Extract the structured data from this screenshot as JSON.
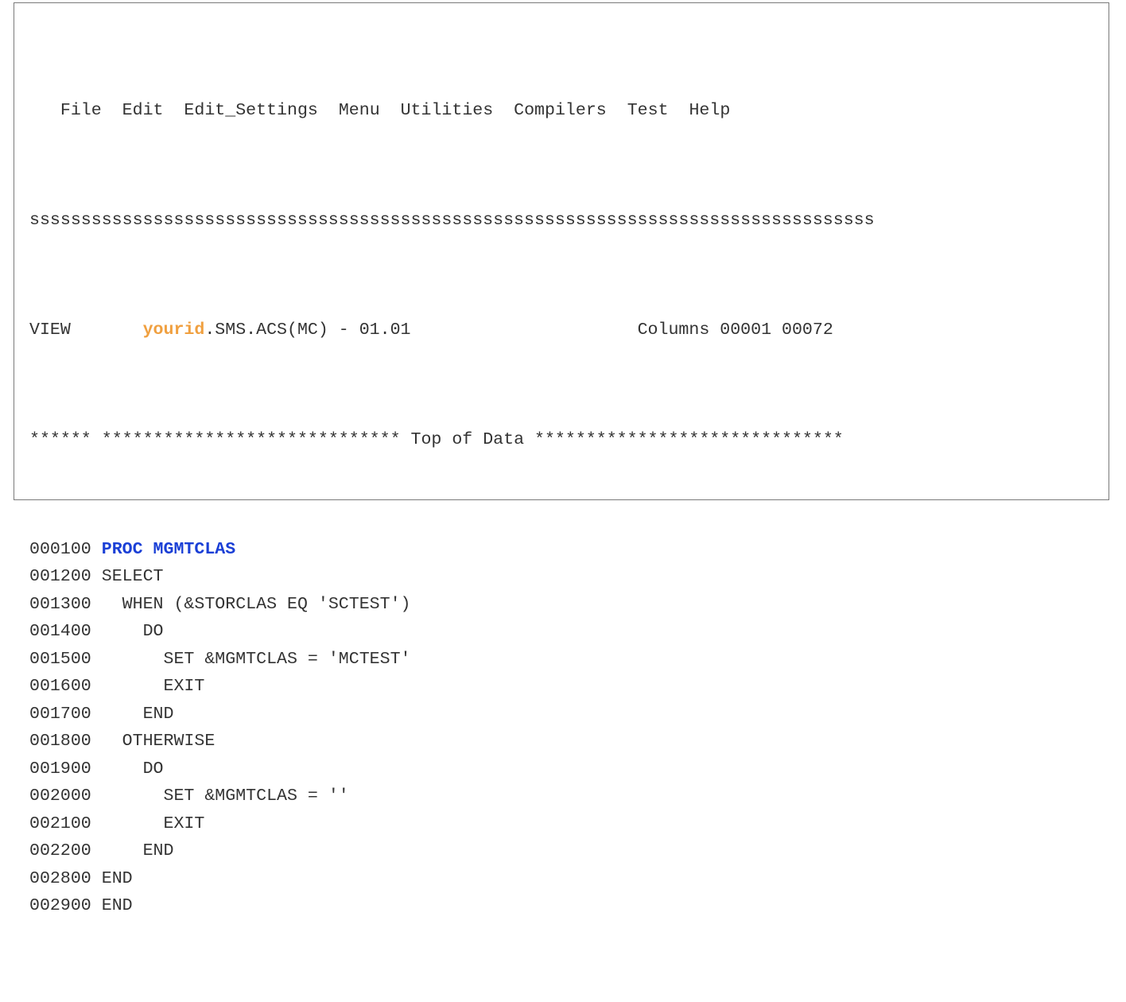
{
  "menu": {
    "items": [
      "File",
      "Edit",
      "Edit_Settings",
      "Menu",
      "Utilities",
      "Compilers",
      "Test",
      "Help"
    ]
  },
  "separator": "ssssssssssssssssssssssssssssssssssssssssssssssssssssssssssssssssssssssssssssssssss",
  "header": {
    "mode": "VIEW",
    "dataset_user": "yourid",
    "dataset_rest": ".SMS.ACS(MC) - 01.01",
    "columns_label": "Columns 00001 00072"
  },
  "top_of_data": {
    "prefix": "******",
    "text": "***************************** Top of Data ******************************"
  },
  "code_lines": [
    {
      "num": "000100",
      "text": "PROC MGMTCLAS"
    },
    {
      "num": "001200",
      "text": "SELECT"
    },
    {
      "num": "001300",
      "text": "  WHEN (&STORCLAS EQ 'SCTEST')"
    },
    {
      "num": "001400",
      "text": "    DO"
    },
    {
      "num": "001500",
      "text": "      SET &MGMTCLAS = 'MCTEST'"
    },
    {
      "num": "001600",
      "text": "      EXIT"
    },
    {
      "num": "001700",
      "text": "    END"
    },
    {
      "num": "001800",
      "text": "  OTHERWISE"
    },
    {
      "num": "001900",
      "text": "    DO"
    },
    {
      "num": "002000",
      "text": "      SET &MGMTCLAS = ''"
    },
    {
      "num": "002100",
      "text": "      EXIT"
    },
    {
      "num": "002200",
      "text": "    END"
    },
    {
      "num": "002800",
      "text": "END"
    },
    {
      "num": "002900",
      "text": "END"
    }
  ],
  "colors": {
    "text": "#333333",
    "user_highlight": "#f0a040",
    "proc_highlight": "#1a3fd6",
    "border": "#7a7a7a"
  }
}
